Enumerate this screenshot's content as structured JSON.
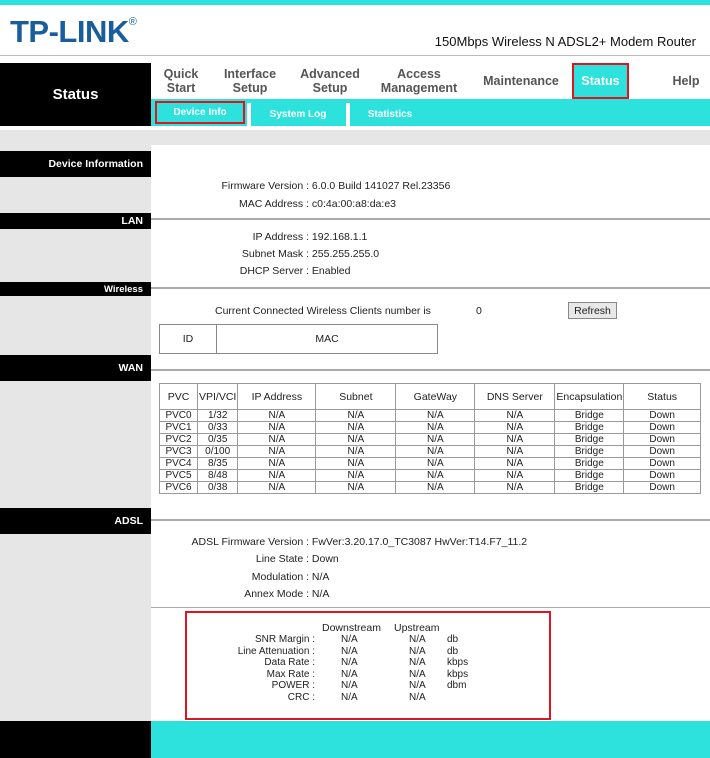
{
  "header": {
    "logo": "TP-LINK",
    "logo_mark": "®",
    "model": "150Mbps Wireless N ADSL2+ Modem Router"
  },
  "side_title": "Status",
  "menu": [
    {
      "line1": "Quick",
      "line2": "Start"
    },
    {
      "line1": "Interface",
      "line2": "Setup"
    },
    {
      "line1": "Advanced",
      "line2": "Setup"
    },
    {
      "line1": "Access",
      "line2": "Management"
    },
    {
      "line1": "Maintenance",
      "line2": ""
    },
    {
      "line1": "Status",
      "line2": "",
      "active": true
    },
    {
      "line1": "Help",
      "line2": ""
    }
  ],
  "subnav": [
    {
      "label": "Device Info",
      "active": true
    },
    {
      "label": "System Log"
    },
    {
      "label": "Statistics"
    }
  ],
  "sections": {
    "device_info": "Device Information",
    "lan": "LAN",
    "wireless": "Wireless",
    "wan": "WAN",
    "adsl": "ADSL"
  },
  "device": {
    "firmware_label": "Firmware Version :",
    "firmware": "6.0.0 Build 141027 Rel.23356",
    "mac_label": "MAC Address :",
    "mac": "c0:4a:00:a8:da:e3"
  },
  "lan": {
    "ip_label": "IP Address :",
    "ip": "192.168.1.1",
    "mask_label": "Subnet Mask :",
    "mask": "255.255.255.0",
    "dhcp_label": "DHCP Server :",
    "dhcp": "Enabled"
  },
  "wireless": {
    "clients_label": "Current Connected Wireless Clients number is",
    "clients": "0",
    "refresh": "Refresh",
    "col_id": "ID",
    "col_mac": "MAC"
  },
  "wan": {
    "headers": [
      "PVC",
      "VPI/VCI",
      "IP Address",
      "Subnet",
      "GateWay",
      "DNS Server",
      "Encapsulation",
      "Status"
    ],
    "rows": [
      [
        "PVC0",
        "1/32",
        "N/A",
        "N/A",
        "N/A",
        "N/A",
        "Bridge",
        "Down"
      ],
      [
        "PVC1",
        "0/33",
        "N/A",
        "N/A",
        "N/A",
        "N/A",
        "Bridge",
        "Down"
      ],
      [
        "PVC2",
        "0/35",
        "N/A",
        "N/A",
        "N/A",
        "N/A",
        "Bridge",
        "Down"
      ],
      [
        "PVC3",
        "0/100",
        "N/A",
        "N/A",
        "N/A",
        "N/A",
        "Bridge",
        "Down"
      ],
      [
        "PVC4",
        "8/35",
        "N/A",
        "N/A",
        "N/A",
        "N/A",
        "Bridge",
        "Down"
      ],
      [
        "PVC5",
        "8/48",
        "N/A",
        "N/A",
        "N/A",
        "N/A",
        "Bridge",
        "Down"
      ],
      [
        "PVC6",
        "0/38",
        "N/A",
        "N/A",
        "N/A",
        "N/A",
        "Bridge",
        "Down"
      ]
    ]
  },
  "adsl": {
    "fw_label": "ADSL Firmware Version :",
    "fw": "FwVer:3.20.17.0_TC3087 HwVer:T14.F7_11.2",
    "line_label": "Line State :",
    "line": "Down",
    "mod_label": "Modulation :",
    "mod": "N/A",
    "annex_label": "Annex Mode :",
    "annex": "N/A",
    "stats_headers": {
      "down": "Downstream",
      "up": "Upstream"
    },
    "stats": [
      {
        "label": "SNR Margin :",
        "down": "N/A",
        "up": "N/A",
        "unit": "db"
      },
      {
        "label": "Line Attenuation :",
        "down": "N/A",
        "up": "N/A",
        "unit": "db"
      },
      {
        "label": "Data Rate :",
        "down": "N/A",
        "up": "N/A",
        "unit": "kbps"
      },
      {
        "label": "Max Rate :",
        "down": "N/A",
        "up": "N/A",
        "unit": "kbps"
      },
      {
        "label": "POWER :",
        "down": "N/A",
        "up": "N/A",
        "unit": "dbm"
      },
      {
        "label": "CRC :",
        "down": "N/A",
        "up": "N/A",
        "unit": ""
      }
    ]
  },
  "colors": {
    "accent": "#2de2dc",
    "highlight": "#e0141e",
    "brand": "#1a5d9c"
  }
}
